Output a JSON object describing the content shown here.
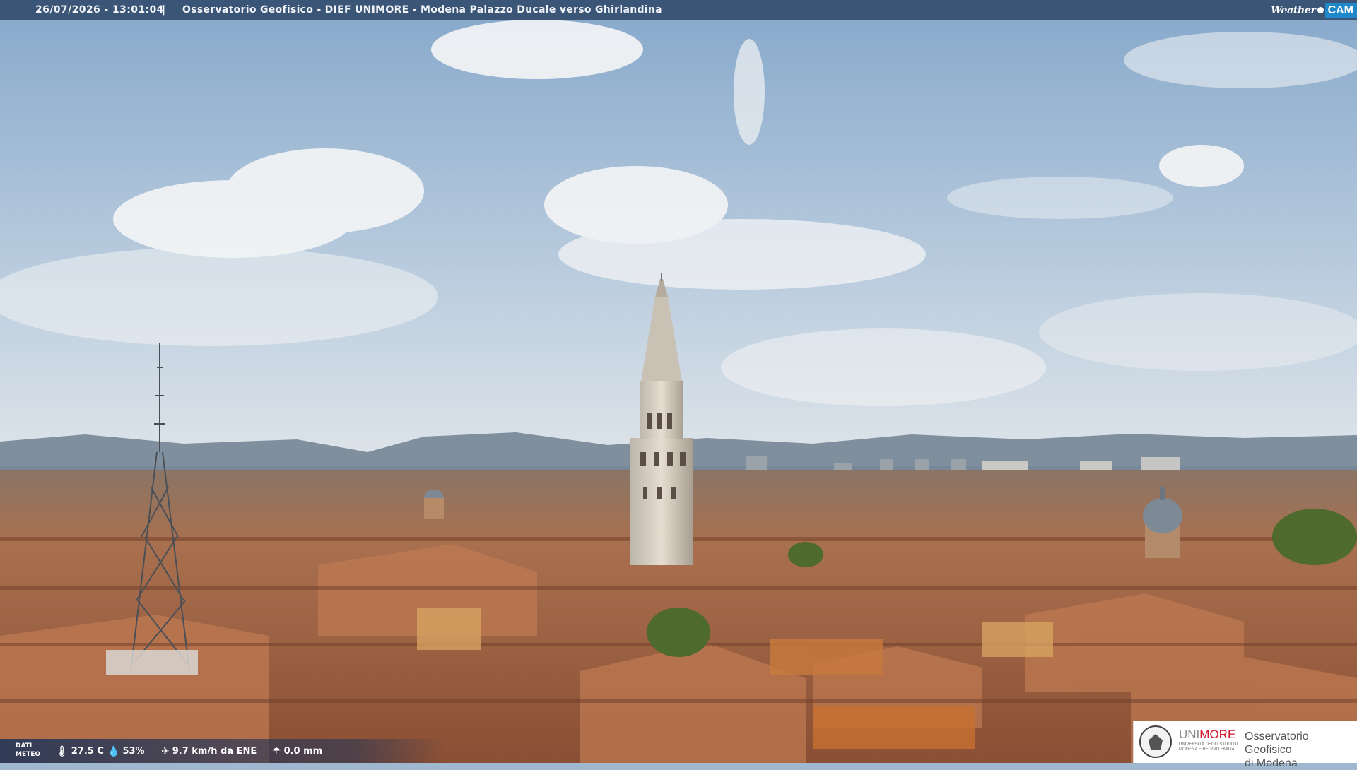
{
  "overlay": {
    "timestamp": "26/07/2026 - 13:01:04",
    "separator": "|",
    "location": "Osservatorio Geofisico - DIEF UNIMORE - Modena Palazzo Ducale verso Ghirlandina",
    "brand_weather": "Weather",
    "brand_cam": "CAM"
  },
  "meteo": {
    "label_line1": "DATI",
    "label_line2": "METEO",
    "temperature": "27.5 C",
    "humidity": "53%",
    "wind": "9.7 km/h da ENE",
    "rain": "0.0 mm",
    "icons": [
      "thermometer-icon",
      "humidity-icon",
      "wind-icon",
      "rain-gauge-icon"
    ]
  },
  "logo": {
    "university_a": "UNI",
    "university_b": "MORE",
    "university_sub": "UNIVERSITÀ DEGLI STUDI DI MODENA E REGGIO EMILIA",
    "observatory_line1": "Osservatorio Geofisico",
    "observatory_line2": "di Modena"
  },
  "colors": {
    "sky_top": "#8fb0d0",
    "sky_bottom": "#d9e3ea",
    "roof": "#b46a45",
    "bar": "#344e70",
    "cam_blue": "#1e88c8",
    "uni_red": "#d3172d"
  }
}
